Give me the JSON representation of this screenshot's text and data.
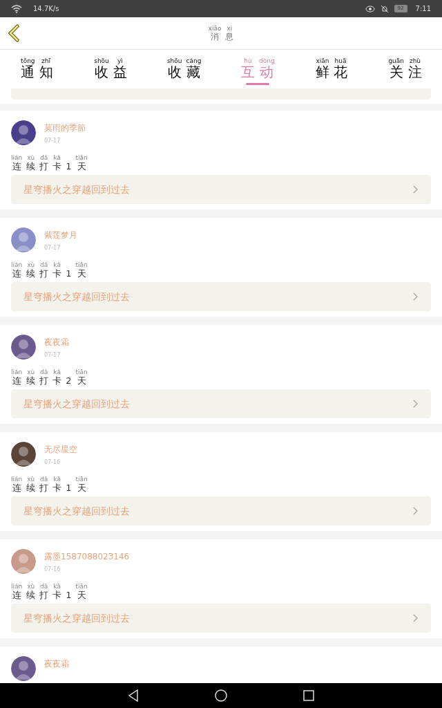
{
  "status_bar": {
    "speed": "14.7K/s",
    "battery": "92",
    "time": "7:11"
  },
  "header": {
    "title": [
      {
        "c": "消",
        "py": "xiāo"
      },
      {
        "c": "息",
        "py": "xi"
      }
    ]
  },
  "tabs": [
    {
      "chars": [
        {
          "c": "通",
          "py": "tōng"
        },
        {
          "c": "知",
          "py": "zhī"
        }
      ],
      "selected": false
    },
    {
      "chars": [
        {
          "c": "收",
          "py": "shōu"
        },
        {
          "c": "益",
          "py": "yì"
        }
      ],
      "selected": false
    },
    {
      "chars": [
        {
          "c": "收",
          "py": "shōu"
        },
        {
          "c": "藏",
          "py": "cáng"
        }
      ],
      "selected": false
    },
    {
      "chars": [
        {
          "c": "互",
          "py": "hù"
        },
        {
          "c": "动",
          "py": "dòng"
        }
      ],
      "selected": true
    },
    {
      "chars": [
        {
          "c": "鲜",
          "py": "xiān"
        },
        {
          "c": "花",
          "py": "huā"
        }
      ],
      "selected": false
    },
    {
      "chars": [
        {
          "c": "关",
          "py": "guān"
        },
        {
          "c": "注",
          "py": "zhù"
        }
      ],
      "selected": false
    }
  ],
  "messages": [
    {
      "name": "莫雨的季節",
      "date": "07-17",
      "text": [
        {
          "c": "连",
          "py": "lián"
        },
        {
          "c": "续",
          "py": "xù"
        },
        {
          "c": "打",
          "py": "dǎ"
        },
        {
          "c": "卡",
          "py": "kǎ"
        },
        {
          "c": "1"
        },
        {
          "c": "天",
          "py": "tiān"
        }
      ],
      "link": "星穹播火之穿越回到过去"
    },
    {
      "name": "紫莲梦月",
      "date": "07-17",
      "text": [
        {
          "c": "连",
          "py": "lián"
        },
        {
          "c": "续",
          "py": "xù"
        },
        {
          "c": "打",
          "py": "dǎ"
        },
        {
          "c": "卡",
          "py": "kǎ"
        },
        {
          "c": "1"
        },
        {
          "c": "天",
          "py": "tiān"
        }
      ],
      "link": "星穹播火之穿越回到过去"
    },
    {
      "name": "夜夜霜",
      "date": "07-17",
      "text": [
        {
          "c": "连",
          "py": "lián"
        },
        {
          "c": "续",
          "py": "xù"
        },
        {
          "c": "打",
          "py": "dǎ"
        },
        {
          "c": "卡",
          "py": "kǎ"
        },
        {
          "c": "2"
        },
        {
          "c": "天",
          "py": "tiān"
        }
      ],
      "link": "星穹播火之穿越回到过去"
    },
    {
      "name": "无尽星空",
      "date": "07-16",
      "text": [
        {
          "c": "连",
          "py": "lián"
        },
        {
          "c": "续",
          "py": "xù"
        },
        {
          "c": "打",
          "py": "dǎ"
        },
        {
          "c": "卡",
          "py": "kǎ"
        },
        {
          "c": "1"
        },
        {
          "c": "天",
          "py": "tiān"
        }
      ],
      "link": "星穹播火之穿越回到过去"
    },
    {
      "name": "露墨1587088023146",
      "date": "07-16",
      "text": [
        {
          "c": "连",
          "py": "lián"
        },
        {
          "c": "续",
          "py": "xù"
        },
        {
          "c": "打",
          "py": "dǎ"
        },
        {
          "c": "卡",
          "py": "kǎ"
        },
        {
          "c": "1"
        },
        {
          "c": "天",
          "py": "tiān"
        }
      ],
      "link": "星穹播火之穿越回到过去"
    },
    {
      "name": "夜夜霜"
    }
  ]
}
